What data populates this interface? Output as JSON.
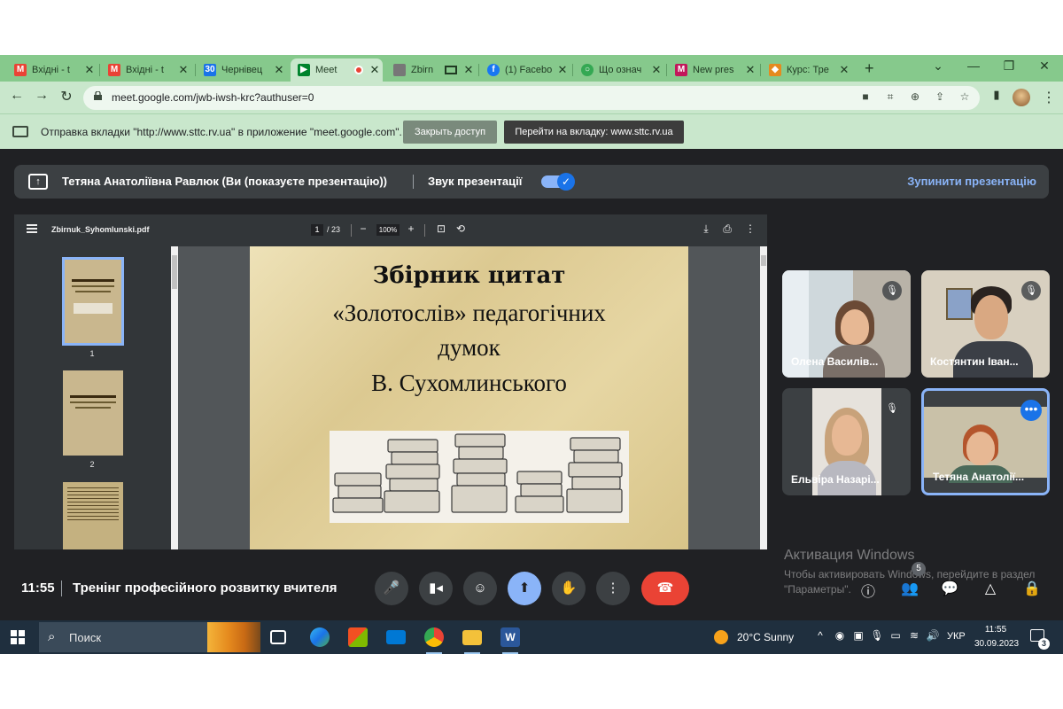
{
  "browser": {
    "tabs": [
      {
        "label": "Вхідні - t",
        "favicon": "gmail-icon",
        "color": "#ea4335"
      },
      {
        "label": "Вхідні - t",
        "favicon": "gmail-icon",
        "color": "#ea4335"
      },
      {
        "label": "Чернівец",
        "favicon": "calendar-icon",
        "color": "#1a73e8"
      },
      {
        "label": "Meet",
        "favicon": "meet-icon",
        "color": "#00832d"
      },
      {
        "label": "Zbirn",
        "favicon": "pdf-icon",
        "color": "#777777"
      },
      {
        "label": "(1) Facebo",
        "favicon": "facebook-icon",
        "color": "#1877f2"
      },
      {
        "label": "Що означ",
        "favicon": "globe-icon",
        "color": "#34a853"
      },
      {
        "label": "New pres",
        "favicon": "slides-icon",
        "color": "#c2185b"
      },
      {
        "label": "Курс: Тре",
        "favicon": "course-icon",
        "color": "#e58a1e"
      }
    ],
    "url": "meet.google.com/jwb-iwsh-krc?authuser=0"
  },
  "infobar": {
    "text": "Отправка вкладки \"http://www.sttc.rv.ua\" в приложение \"meet.google.com\"...",
    "stop_label": "Закрыть доступ",
    "goto_label": "Перейти на вкладку: www.sttc.rv.ua"
  },
  "presenting": {
    "name": "Тетяна Анатоліївна Равлюк (Ви (показуєте презентацію))",
    "sound_label": "Звук презентації",
    "stop_label": "Зупинити презентацію"
  },
  "pdf": {
    "filename": "Zbirnuk_Syhomlunski.pdf",
    "page": "1",
    "total": "/ 23",
    "zoom": "100%",
    "thumb_numbers": [
      "1",
      "2"
    ],
    "title": "Збірник цитат",
    "lines": [
      "«Золотослів» педагогічних",
      "думок",
      "В. Сухомлинського"
    ]
  },
  "participants": [
    {
      "name": "Олена Василів..."
    },
    {
      "name": "Костянтин Іван..."
    },
    {
      "name": "Ельвіра Назарі..."
    },
    {
      "name": "Тетяна Анатолії..."
    }
  ],
  "watermark": {
    "line1": "Активация Windows",
    "line2": "Чтобы активировать Windows, перейдите в раздел \"Параметры\"."
  },
  "meeting": {
    "time": "11:55",
    "title": "Тренінг професійного розвитку вчителя",
    "people_count": "5"
  },
  "taskbar": {
    "search": "Поиск",
    "weather": "20°C  Sunny",
    "lang": "УКР",
    "time": "11:55",
    "date": "30.09.2023",
    "notifications": "3"
  }
}
